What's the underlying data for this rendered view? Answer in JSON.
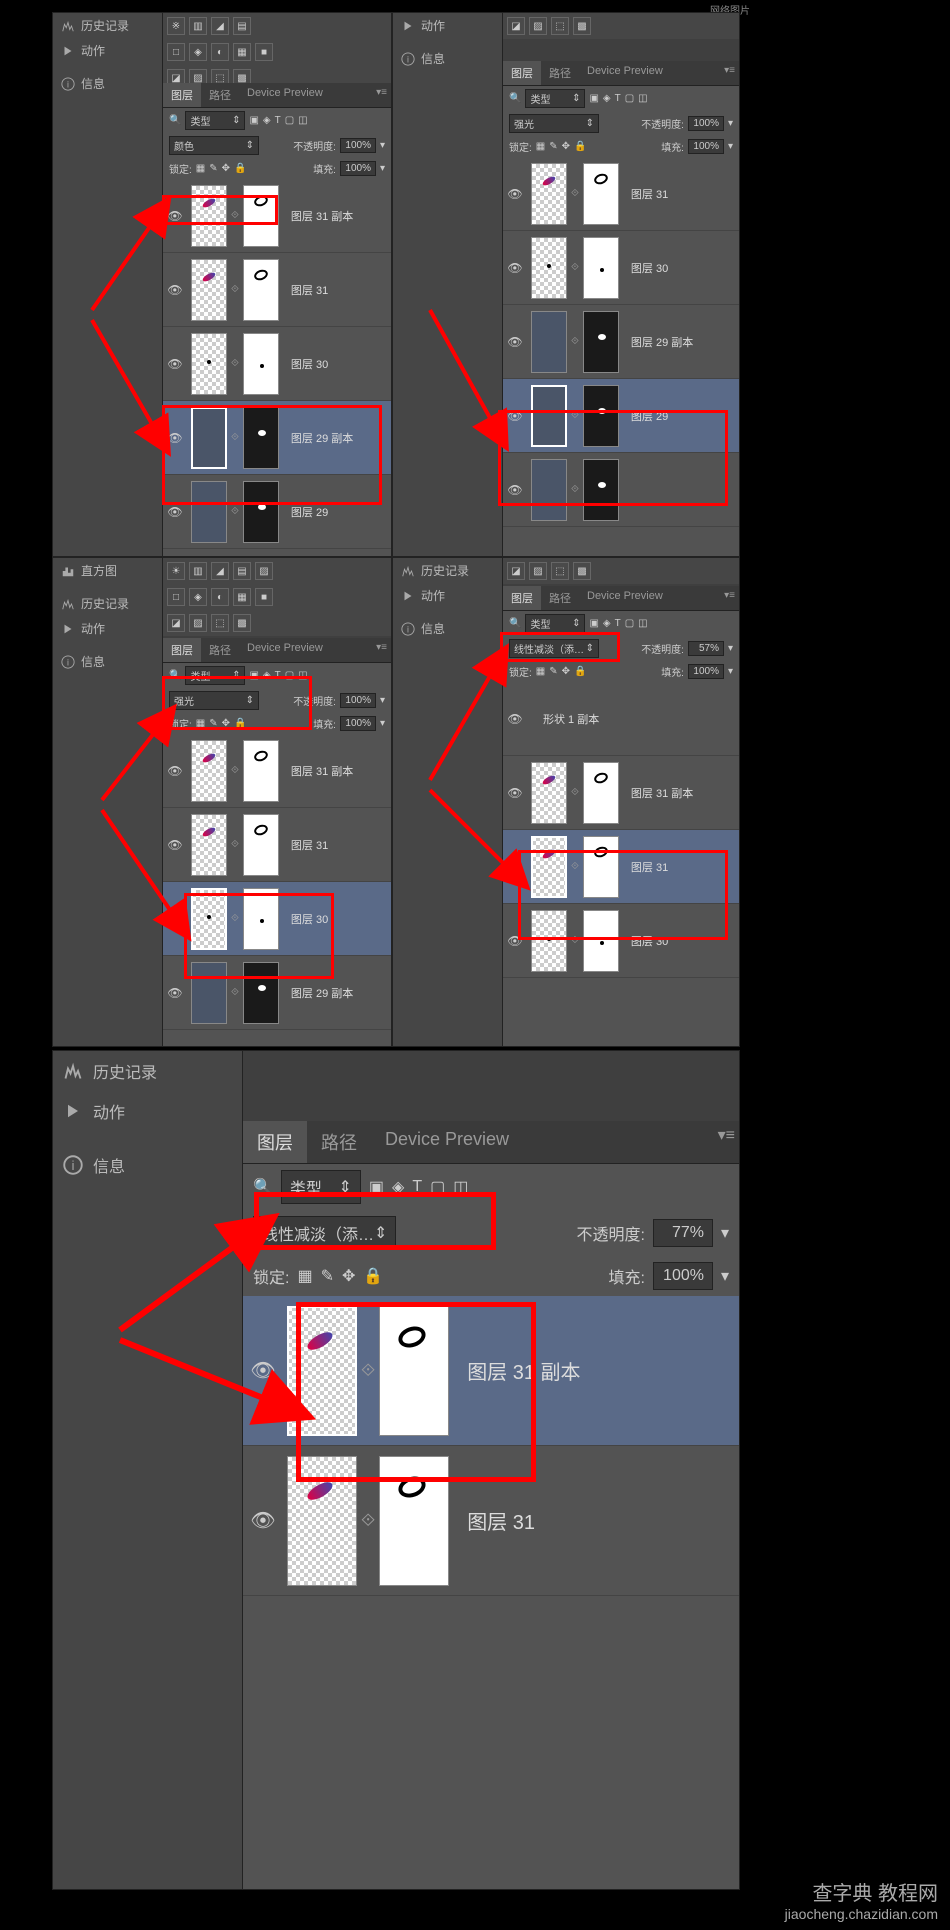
{
  "sidebar": {
    "history": "历史记录",
    "actions": "动作",
    "info": "信息",
    "histogram": "直方图"
  },
  "layers_panel": {
    "tab_layers": "图层",
    "tab_paths": "路径",
    "tab_device": "Device Preview",
    "filter_type": "类型",
    "opacity_label": "不透明度:",
    "fill_label": "填充:",
    "lock_label": "锁定:"
  },
  "panels": [
    {
      "id": "p1",
      "blend": "颜色",
      "opacity": "100%",
      "fill": "100%",
      "layers": [
        {
          "name": "图层 31 副本",
          "t1": "feather",
          "t2": "blob-white"
        },
        {
          "name": "图层 31",
          "t1": "feather",
          "t2": "blob-white"
        },
        {
          "name": "图层 30",
          "t1": "checker",
          "t2": "dot-white"
        },
        {
          "name": "图层 29 副本",
          "t1": "slate-sel",
          "t2": "spot-dark",
          "sel": true,
          "hl": true
        },
        {
          "name": "图层 29",
          "t1": "slate",
          "t2": "spot-dark"
        }
      ]
    },
    {
      "id": "p2",
      "blend": "强光",
      "opacity": "100%",
      "fill": "100%",
      "layers": [
        {
          "name": "图层 31",
          "t1": "feather",
          "t2": "blob-white"
        },
        {
          "name": "图层 30",
          "t1": "checker",
          "t2": "dot-white"
        },
        {
          "name": "图层 29 副本",
          "t1": "slate",
          "t2": "spot-dark"
        },
        {
          "name": "图层 29",
          "t1": "slate-sel",
          "t2": "spot-dark",
          "sel": true,
          "hl": true
        },
        {
          "name": "",
          "t1": "slate",
          "t2": "spot-dark"
        }
      ]
    },
    {
      "id": "p3",
      "blend": "强光",
      "opacity": "100%",
      "fill": "100%",
      "layers": [
        {
          "name": "图层 31 副本",
          "t1": "feather",
          "t2": "blob-white"
        },
        {
          "name": "图层 31",
          "t1": "feather",
          "t2": "blob-white"
        },
        {
          "name": "图层 30",
          "t1": "checker-sel",
          "t2": "dot-white",
          "sel": true,
          "hl": true
        },
        {
          "name": "图层 29 副本",
          "t1": "slate",
          "t2": "spot-dark"
        }
      ]
    },
    {
      "id": "p4",
      "blend": "线性减淡（添…",
      "opacity": "57%",
      "fill": "100%",
      "layers": [
        {
          "name": "形状 1 副本",
          "t1": "none",
          "t2": "none"
        },
        {
          "name": "图层 31 副本",
          "t1": "feather",
          "t2": "blob-white"
        },
        {
          "name": "图层 31",
          "t1": "feather-sel",
          "t2": "blob-white",
          "sel": true,
          "hl": true
        },
        {
          "name": "图层 30",
          "t1": "checker",
          "t2": "dot-white"
        }
      ]
    }
  ],
  "panel_big": {
    "blend": "线性减淡（添…",
    "opacity": "77%",
    "fill": "100%",
    "layers": [
      {
        "name": "图层 31 副本",
        "t1": "feather-sel",
        "t2": "blob-white",
        "sel": true,
        "hl": true
      },
      {
        "name": "图层 31",
        "t1": "feather",
        "t2": "blob-white"
      }
    ]
  },
  "watermark": {
    "cn": "查字典 教程网",
    "url": "jiaocheng.chazidian.com"
  },
  "top_text": "网络图片"
}
